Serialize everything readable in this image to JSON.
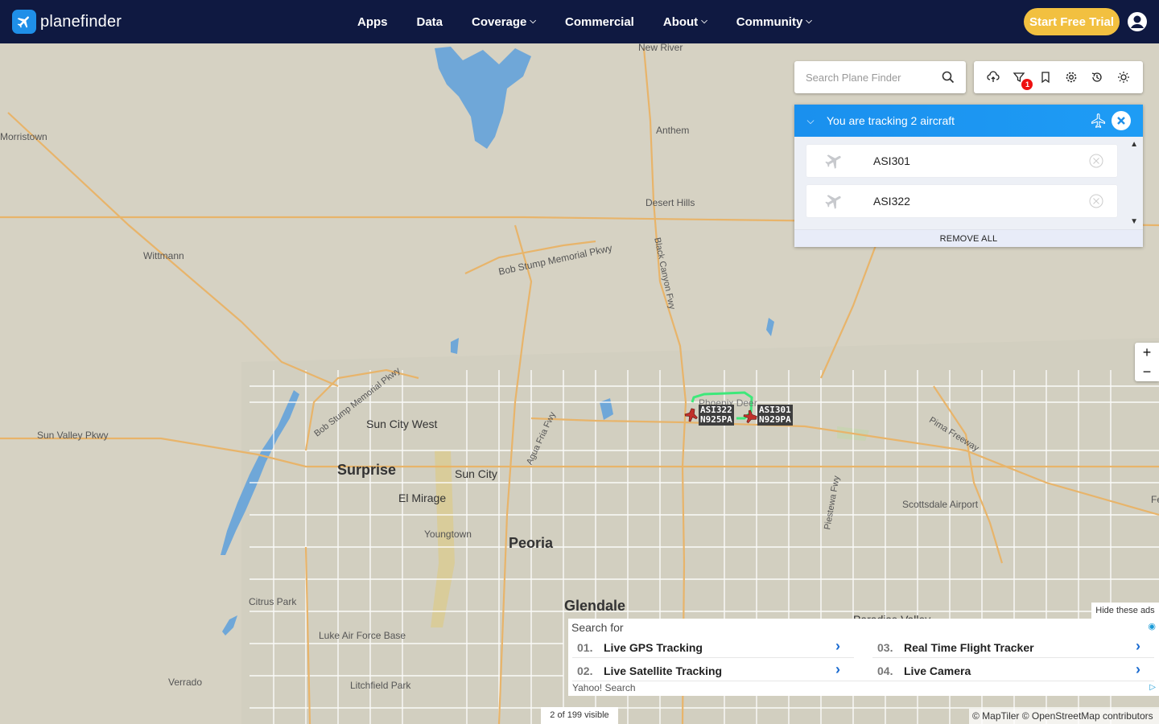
{
  "brand": {
    "name": "planefinder"
  },
  "nav": {
    "items": [
      {
        "label": "Apps",
        "dropdown": false
      },
      {
        "label": "Data",
        "dropdown": false
      },
      {
        "label": "Coverage",
        "dropdown": true
      },
      {
        "label": "Commercial",
        "dropdown": false
      },
      {
        "label": "About",
        "dropdown": true
      },
      {
        "label": "Community",
        "dropdown": true
      }
    ],
    "trial_label": "Start Free Trial"
  },
  "search": {
    "placeholder": "Search Plane Finder",
    "value": ""
  },
  "toolbar": {
    "icons": [
      "cloud-upload-icon",
      "filter-icon",
      "bookmark-icon",
      "settings-icon",
      "history-icon",
      "airport-weather-icon"
    ],
    "filter_badge": "1"
  },
  "tracking": {
    "title": "You are tracking 2 aircraft",
    "aircraft": [
      {
        "callsign": "ASI301"
      },
      {
        "callsign": "ASI322"
      }
    ],
    "remove_all_label": "REMOVE ALL"
  },
  "zoom": {
    "in_label": "+",
    "out_label": "−"
  },
  "map_labels": {
    "new_river": "New River",
    "morristown": "Morristown",
    "anthem": "Anthem",
    "desert_hills": "Desert Hills",
    "wittmann": "Wittmann",
    "bob_stump": "Bob Stump Memorial Pkwy",
    "black_canyon": "Black Canyon Fwy",
    "sun_city_west": "Sun City West",
    "sun_valley": "Sun Valley Pkwy",
    "surprise": "Surprise",
    "sun_city": "Sun City",
    "el_mirage": "El Mirage",
    "youngtown": "Youngtown",
    "peoria": "Peoria",
    "glendale": "Glendale",
    "citrus_park": "Citrus Park",
    "luke_afb": "Luke Air Force Base",
    "litchfield": "Litchfield Park",
    "verrado": "Verrado",
    "scottsdale_airport": "Scottsdale Airport",
    "pima_fwy": "Pima Freeway",
    "piestewa": "Piestewa Fwy",
    "agua_fria": "Agua Fria Fwy",
    "phoenix_deer": "Phoenix Deer",
    "paradise_valley": "Paradise Valley",
    "fe": "Fe"
  },
  "aircraft_labels": [
    {
      "callsign": "ASI322",
      "reg": "N925PA"
    },
    {
      "callsign": "ASI301",
      "reg": "N929PA"
    }
  ],
  "ad": {
    "hide_label": "Hide these ads",
    "search_for": "Search for",
    "items": [
      {
        "num": "01.",
        "text": "Live GPS Tracking"
      },
      {
        "num": "02.",
        "text": "Live Satellite Tracking"
      },
      {
        "num": "03.",
        "text": "Real Time Flight Tracker"
      },
      {
        "num": "04.",
        "text": "Live Camera"
      }
    ],
    "provider": "Yahoo! Search"
  },
  "status": {
    "visible_count": "2 of 199 visible",
    "attribution": "© MapTiler © OpenStreetMap contributors"
  },
  "colors": {
    "navbar": "#0f1941",
    "accent": "#1e9cf5",
    "trial": "#f2c040",
    "track_line": "#3ee87a",
    "aircraft": "#c0302a"
  }
}
